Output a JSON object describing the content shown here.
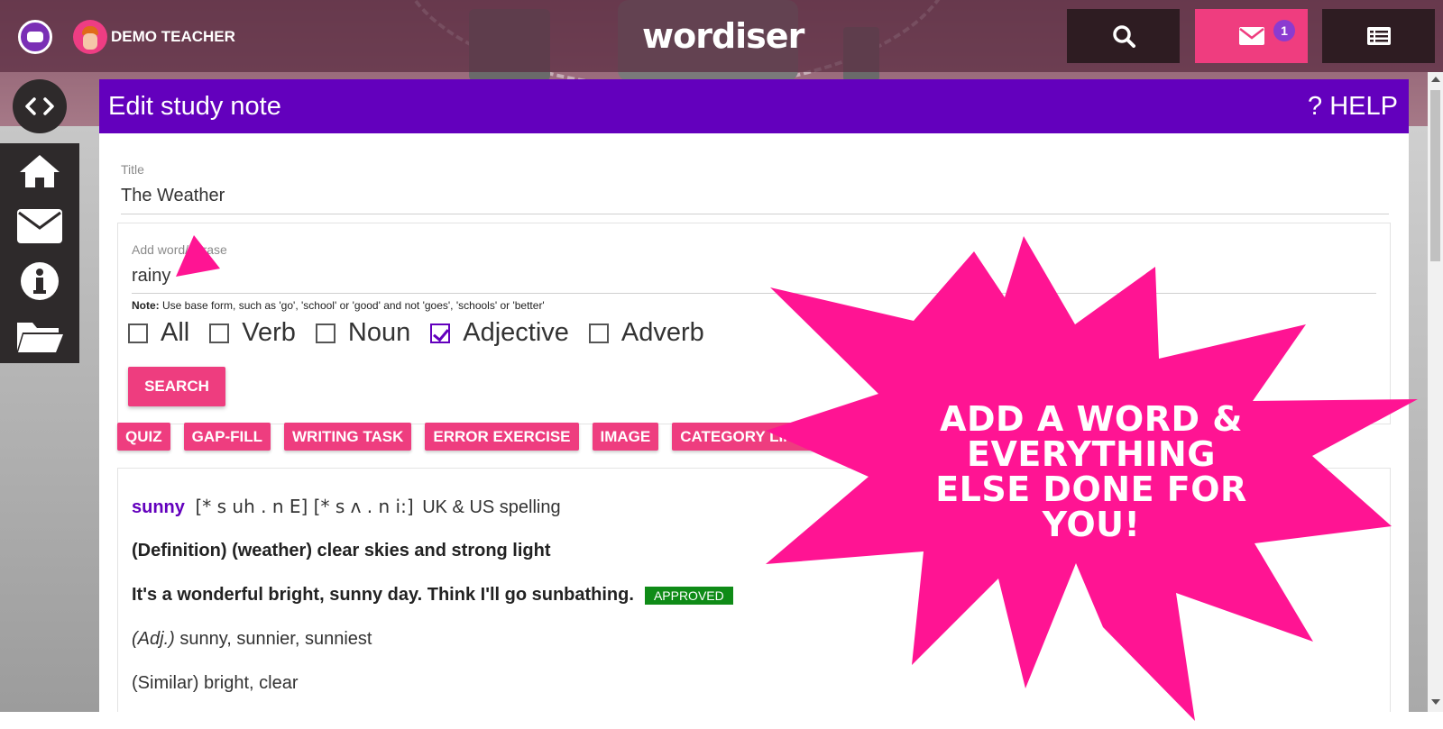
{
  "header": {
    "user_name": "DEMO TEACHER",
    "logo": "wordiser",
    "mail_badge": "1",
    "icons": [
      "menu-avatar-icon",
      "search-icon",
      "envelope-icon",
      "notes-list-icon"
    ]
  },
  "sidebar": {
    "toggle_icon": "code-brackets-icon",
    "items": [
      "home-icon",
      "envelope-icon",
      "info-icon",
      "folder-open-icon"
    ]
  },
  "card": {
    "title": "Edit study note",
    "help": "? HELP",
    "title_field": {
      "label": "Title",
      "value": "The Weather"
    },
    "add_word": {
      "label": "Add word/phrase",
      "value": "rainy",
      "note_label": "Note:",
      "note_text": " Use base form, such as 'go', 'school' or 'good' and not 'goes', 'schools' or 'better'",
      "checkboxes": [
        {
          "label": "All",
          "checked": false
        },
        {
          "label": "Verb",
          "checked": false
        },
        {
          "label": "Noun",
          "checked": false
        },
        {
          "label": "Adjective",
          "checked": true
        },
        {
          "label": "Adverb",
          "checked": false
        }
      ],
      "search_label": "SEARCH"
    },
    "tools": [
      "QUIZ",
      "GAP-FILL",
      "WRITING TASK",
      "ERROR EXERCISE",
      "IMAGE",
      "CATEGORY LINK"
    ],
    "entry": {
      "word": "sunny",
      "phonetic": "[* s uh . n E] [* s ʌ . n i:]",
      "spelling": "UK & US spelling",
      "definition": "(Definition) (weather) clear skies and strong light",
      "example": "It's a wonderful bright, sunny day. Think I'll go sunbathing.",
      "status": "APPROVED",
      "forms_pos": "(Adj.)",
      "forms": " sunny, sunnier, sunniest",
      "similar": "(Similar) bright, clear"
    }
  },
  "promo": {
    "text": "ADD A WORD & EVERYTHING ELSE DONE FOR YOU!"
  },
  "colors": {
    "accent_purple": "#6300bd",
    "accent_pink": "#ee3d7f",
    "approved_green": "#0f8b17"
  }
}
